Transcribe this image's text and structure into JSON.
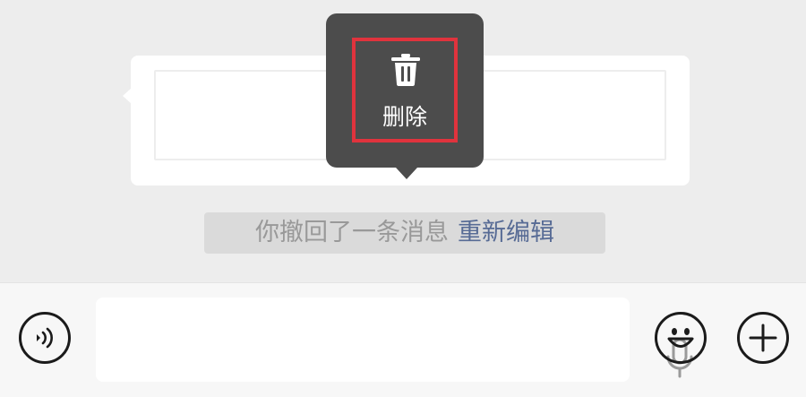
{
  "context_menu": {
    "delete_label": "删除",
    "delete_icon": "trash-icon",
    "highlight_color": "#e0333d"
  },
  "recall_notice": {
    "text": "你撤回了一条消息",
    "reedit_label": "重新编辑",
    "link_color": "#576b95"
  },
  "input_bar": {
    "voice_icon": "voice-icon",
    "input_value": "",
    "mic_icon": "mic-icon",
    "emoji_icon": "emoji-icon",
    "plus_icon": "plus-icon"
  }
}
